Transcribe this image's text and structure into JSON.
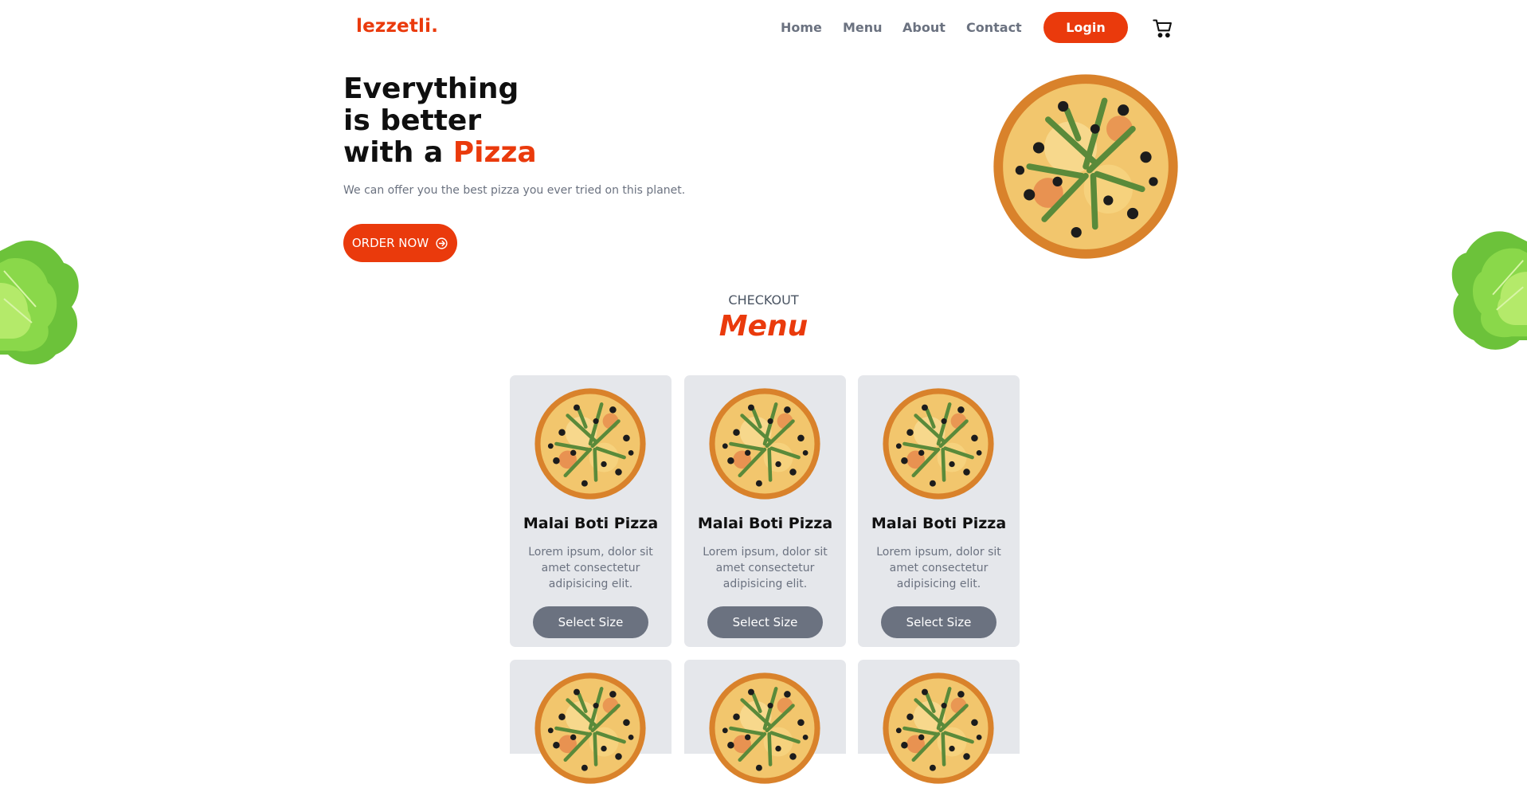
{
  "brand": {
    "logo": "lezzetli."
  },
  "nav": {
    "items": [
      {
        "label": "Home"
      },
      {
        "label": "Menu"
      },
      {
        "label": "About"
      },
      {
        "label": "Contact"
      }
    ],
    "login_label": "Login",
    "cart_icon": "cart-icon"
  },
  "hero": {
    "line1": "Everything",
    "line2": "is better",
    "line3_prefix": "with a ",
    "line3_accent": "Pizza",
    "subtitle": "We can offer you the best pizza you ever tried on this planet.",
    "cta_label": "ORDER NOW",
    "cta_icon": "arrow-circle-right-icon"
  },
  "menu_section": {
    "eyebrow": "CHECKOUT",
    "title": "Menu",
    "cards": [
      {
        "name": "Malai Boti Pizza",
        "desc": "Lorem ipsum, dolor sit amet consectetur adipisicing elit.",
        "button": "Select Size"
      },
      {
        "name": "Malai Boti Pizza",
        "desc": "Lorem ipsum, dolor sit amet consectetur adipisicing elit.",
        "button": "Select Size"
      },
      {
        "name": "Malai Boti Pizza",
        "desc": "Lorem ipsum, dolor sit amet consectetur adipisicing elit.",
        "button": "Select Size"
      },
      {
        "name": "",
        "desc": "",
        "button": ""
      },
      {
        "name": "",
        "desc": "",
        "button": ""
      },
      {
        "name": "",
        "desc": "",
        "button": ""
      }
    ]
  },
  "colors": {
    "accent": "#ea3a0c",
    "muted": "#6b7280",
    "card_bg": "#e5e7eb"
  }
}
